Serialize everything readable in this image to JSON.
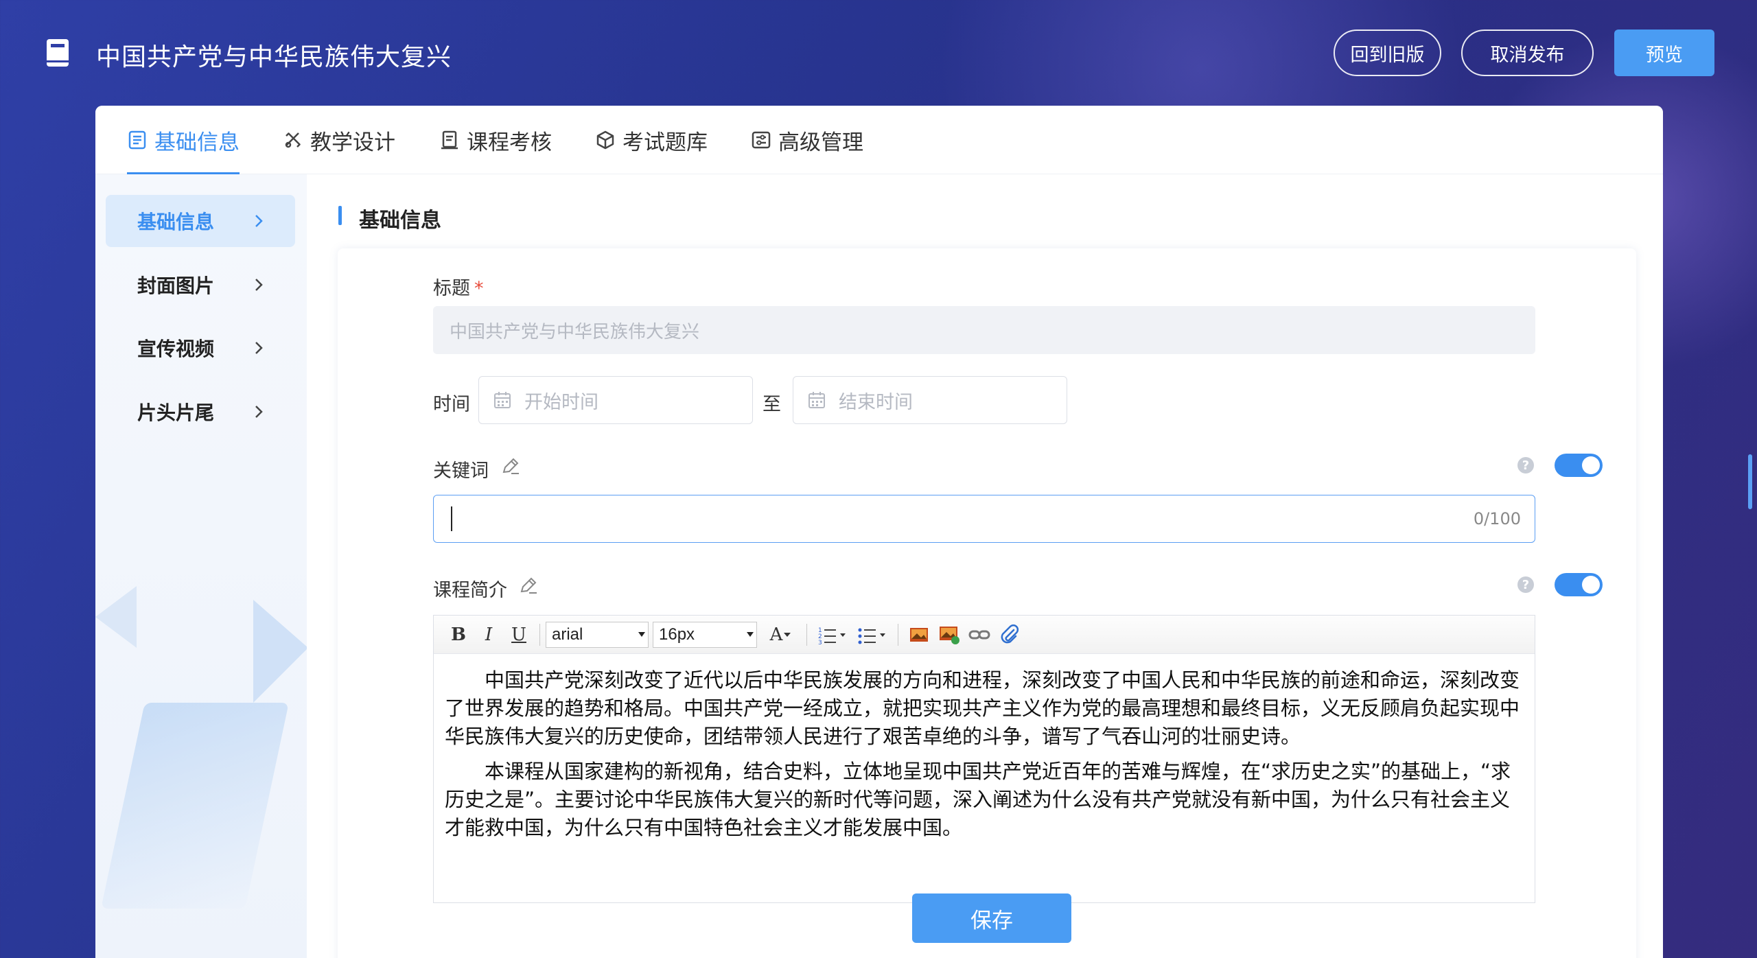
{
  "header": {
    "title": "中国共产党与中华民族伟大复兴",
    "buttons": {
      "back_old": "回到旧版",
      "cancel_publish": "取消发布",
      "preview": "预览"
    }
  },
  "tabs": [
    {
      "label": "基础信息",
      "icon": "document-icon",
      "active": true
    },
    {
      "label": "教学设计",
      "icon": "design-icon",
      "active": false
    },
    {
      "label": "课程考核",
      "icon": "exam-icon",
      "active": false
    },
    {
      "label": "考试题库",
      "icon": "cube-icon",
      "active": false
    },
    {
      "label": "高级管理",
      "icon": "settings-sliders-icon",
      "active": false
    }
  ],
  "sidebar": {
    "items": [
      {
        "label": "基础信息",
        "active": true
      },
      {
        "label": "封面图片",
        "active": false
      },
      {
        "label": "宣传视频",
        "active": false
      },
      {
        "label": "片头片尾",
        "active": false
      }
    ]
  },
  "section": {
    "title": "基础信息"
  },
  "form": {
    "title_label": "标题",
    "required_mark": "*",
    "title_value": "中国共产党与中华民族伟大复兴",
    "time_label": "时间",
    "start_placeholder": "开始时间",
    "to_label": "至",
    "end_placeholder": "结束时间",
    "keyword_label": "关键词",
    "keyword_count": "0/100",
    "intro_label": "课程简介",
    "keyword_toggle_on": true,
    "intro_toggle_on": true,
    "help_mark": "?"
  },
  "editor": {
    "toolbar": {
      "bold": "B",
      "italic": "I",
      "underline": "U",
      "font_family": "arial",
      "font_size": "16px",
      "font_color": "A"
    },
    "paragraphs": [
      "中国共产党深刻改变了近代以后中华民族发展的方向和进程，深刻改变了中国人民和中华民族的前途和命运，深刻改变了世界发展的趋势和格局。中国共产党一经成立，就把实现共产主义作为党的最高理想和最终目标，义无反顾肩负起实现中华民族伟大复兴的历史使命，团结带领人民进行了艰苦卓绝的斗争，谱写了气吞山河的壮丽史诗。",
      "本课程从国家建构的新视角，结合史料，立体地呈现中国共产党近百年的苦难与辉煌，在“求历史之实”的基础上，“求历史之是”。主要讨论中华民族伟大复兴的新时代等问题，深入阐述为什么没有共产党就没有新中国，为什么只有社会主义才能救中国，为什么只有中国特色社会主义才能发展中国。"
    ]
  },
  "save_label": "保存",
  "colors": {
    "accent": "#3a8ef0",
    "header_bg": "#2b3590",
    "button_primary": "#4a9cf3"
  }
}
